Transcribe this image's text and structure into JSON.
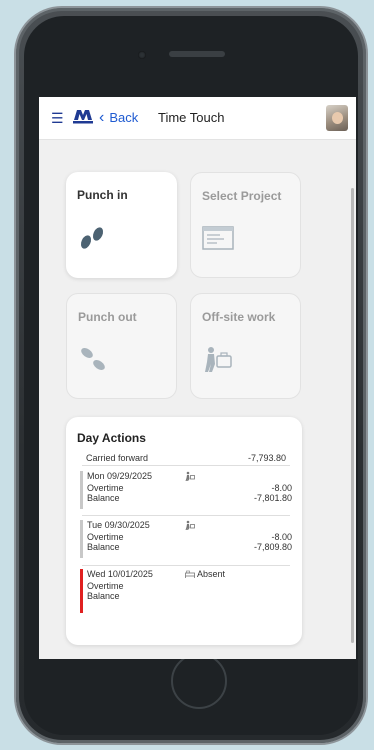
{
  "header": {
    "back_label": "Back",
    "title": "Time Touch"
  },
  "tiles": [
    {
      "label": "Punch in",
      "state": "active",
      "icon": "footsteps-icon"
    },
    {
      "label": "Select Project",
      "state": "inactive",
      "icon": "project-window-icon"
    },
    {
      "label": "Punch out",
      "state": "inactive",
      "icon": "footsteps-out-icon"
    },
    {
      "label": "Off-site work",
      "state": "inactive",
      "icon": "briefcase-walk-icon"
    }
  ],
  "day_actions": {
    "title": "Day Actions",
    "carried_forward_label": "Carried forward",
    "carried_forward_value": "-7,793.80",
    "entries": [
      {
        "date": "Mon 09/29/2025",
        "status_label": "",
        "bar_color": "#c8c8c8",
        "overtime_label": "Overtime",
        "overtime_value": "-8.00",
        "balance_label": "Balance",
        "balance_value": "-7,801.80"
      },
      {
        "date": "Tue 09/30/2025",
        "status_label": "",
        "bar_color": "#c8c8c8",
        "overtime_label": "Overtime",
        "overtime_value": "-8.00",
        "balance_label": "Balance",
        "balance_value": "-7,809.80"
      },
      {
        "date": "Wed 10/01/2025",
        "status_label": "Absent",
        "bar_color": "#e02020",
        "overtime_label": "Overtime",
        "overtime_value": "",
        "balance_label": "Balance",
        "balance_value": ""
      }
    ]
  },
  "colors": {
    "accent": "#1f5bd1",
    "absent_bar": "#e02020"
  }
}
